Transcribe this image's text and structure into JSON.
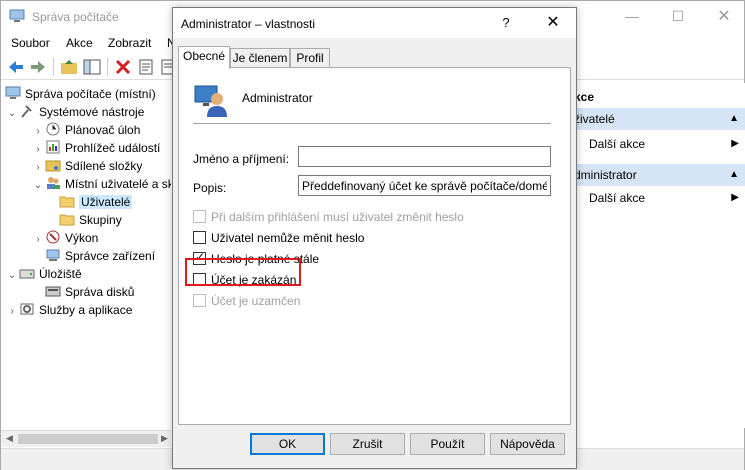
{
  "main_window": {
    "title": "Správa počítače",
    "menu": [
      "Soubor",
      "Akce",
      "Zobrazit",
      "N"
    ],
    "tree": [
      {
        "label": "Správa počítače (místní)"
      },
      {
        "label": "Systémové nástroje"
      },
      {
        "label": "Plánovač úloh"
      },
      {
        "label": "Prohlížeč událostí"
      },
      {
        "label": "Sdílené složky"
      },
      {
        "label": "Místní uživatelé a sk"
      },
      {
        "label": "Uživatelé"
      },
      {
        "label": "Skupiny"
      },
      {
        "label": "Výkon"
      },
      {
        "label": "Správce zařízení"
      },
      {
        "label": "Úložiště"
      },
      {
        "label": "Správa disků"
      },
      {
        "label": "Služby a aplikace"
      }
    ],
    "actions": {
      "header": "kce",
      "section1": "živatelé",
      "section1_item": "Další akce",
      "section2": "dministrator",
      "section2_item": "Další akce"
    }
  },
  "dialog": {
    "title": "Administrator – vlastnosti",
    "help_glyph": "?",
    "close_glyph": "✕",
    "tabs": [
      "Obecné",
      "Je členem",
      "Profil"
    ],
    "user_name": "Administrator",
    "full_name_label": "Jméno a příjmení:",
    "full_name_value": "",
    "description_label": "Popis:",
    "description_value": "Předdefinovaný účet ke správě počítače/domény",
    "checkboxes": [
      {
        "label": "Při dalším přihlášení musí uživatel změnit heslo",
        "checked": false,
        "enabled": false
      },
      {
        "label": "Uživatel nemůže měnit heslo",
        "checked": false,
        "enabled": true
      },
      {
        "label": "Heslo je platné stále",
        "checked": true,
        "enabled": true
      },
      {
        "label": "Účet je zakázán",
        "checked": false,
        "enabled": true
      },
      {
        "label": "Účet je uzamčen",
        "checked": false,
        "enabled": false
      }
    ],
    "buttons": {
      "ok": "OK",
      "cancel": "Zrušit",
      "apply": "Použít",
      "help": "Nápověda"
    }
  },
  "colors": {
    "highlight": "#e0191b",
    "selection": "#cce8ff",
    "action_section": "#d6e5f5"
  }
}
